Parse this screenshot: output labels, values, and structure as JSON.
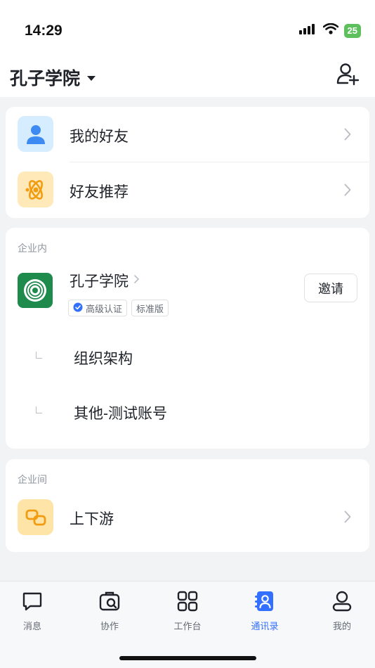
{
  "status": {
    "time": "14:29",
    "battery": "25"
  },
  "header": {
    "org_name": "孔子学院"
  },
  "top_card": {
    "items": [
      {
        "label": "我的好友"
      },
      {
        "label": "好友推荐"
      }
    ]
  },
  "internal": {
    "section_title": "企业内",
    "org": {
      "name": "孔子学院",
      "badges": [
        "高级认证",
        "标准版"
      ],
      "invite_label": "邀请"
    },
    "sub_items": [
      {
        "label": "组织架构"
      },
      {
        "label": "其他-测试账号"
      }
    ]
  },
  "external": {
    "section_title": "企业间",
    "items": [
      {
        "label": "上下游"
      }
    ]
  },
  "tabs": [
    {
      "label": "消息",
      "icon": "chat-bubble-icon",
      "active": false
    },
    {
      "label": "协作",
      "icon": "collaborate-icon",
      "active": false
    },
    {
      "label": "工作台",
      "icon": "grid-icon",
      "active": false
    },
    {
      "label": "通讯录",
      "icon": "contacts-icon",
      "active": true
    },
    {
      "label": "我的",
      "icon": "profile-icon",
      "active": false
    }
  ],
  "colors": {
    "accent": "#3370ff",
    "friends_icon_bg": "#d6ecff",
    "recommend_icon_bg": "#ffe9b8",
    "org_logo_bg": "#1e8a4c",
    "partner_icon_bg": "#ffe4a8"
  }
}
